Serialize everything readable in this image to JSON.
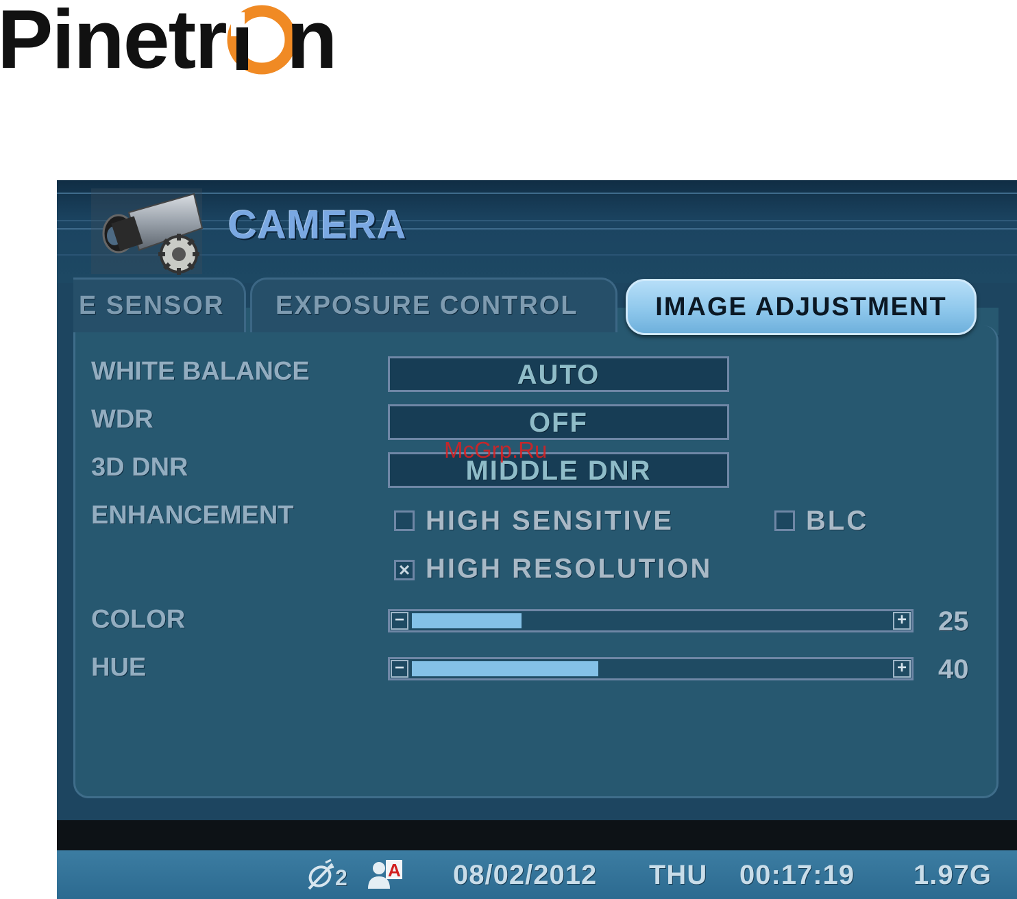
{
  "logo": {
    "text": "Pinetron"
  },
  "screen": {
    "title": "CAMERA",
    "camera_icon": "camera-gear-icon"
  },
  "tabs": [
    {
      "label": "E SENSOR",
      "active": false
    },
    {
      "label": "EXPOSURE CONTROL",
      "active": false
    },
    {
      "label": "IMAGE ADJUSTMENT",
      "active": true
    }
  ],
  "settings": {
    "white_balance": {
      "label": "WHITE BALANCE",
      "value": "AUTO"
    },
    "wdr": {
      "label": "WDR",
      "value": "OFF"
    },
    "dnr": {
      "label": "3D DNR",
      "value": "MIDDLE DNR"
    },
    "enhancement": {
      "label": "ENHANCEMENT",
      "options": [
        {
          "label": "HIGH SENSITIVE",
          "checked": false
        },
        {
          "label": "BLC",
          "checked": false
        },
        {
          "label": "HIGH RESOLUTION",
          "checked": true
        }
      ],
      "check_mark": "×"
    },
    "color": {
      "label": "COLOR",
      "value": "25",
      "level_fraction": 0.23
    },
    "hue": {
      "label": "HUE",
      "value": "40",
      "level_fraction": 0.39
    },
    "minus_symbol": "−",
    "plus_symbol": "+"
  },
  "status_bar": {
    "camera_count": "2",
    "date": "08/02/2012",
    "day": "THU",
    "time": "00:17:19",
    "storage": "1.97G",
    "icons": [
      "satellite-signal-icon",
      "user-a-icon"
    ]
  },
  "watermark": "McGrp.Ru",
  "colors": {
    "logo_orange": "#f08a24",
    "screen_bg": "#1d4560",
    "panel_bg": "#275870",
    "active_tab": "#8fc8ec",
    "slider_fill": "#84c1e7",
    "status_bar": "#34739a"
  }
}
